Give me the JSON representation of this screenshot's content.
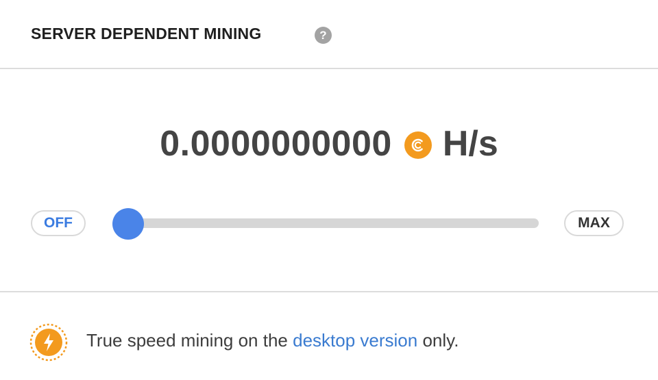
{
  "header": {
    "title": "SERVER DEPENDENT MINING",
    "help_icon": "help-icon",
    "help_glyph": "?"
  },
  "rate": {
    "value": "0.0000000000",
    "coin_icon": "coin-icon",
    "unit": "H/s"
  },
  "slider": {
    "min_label": "OFF",
    "max_label": "MAX",
    "level": 0
  },
  "footer": {
    "icon": "lightning-bolt-icon",
    "text_before": "True speed mining on the ",
    "link_text": "desktop version",
    "text_after": " only."
  },
  "colors": {
    "accent": "#4a84e8",
    "coin": "#f39a1e",
    "link": "#3a7bd0"
  }
}
